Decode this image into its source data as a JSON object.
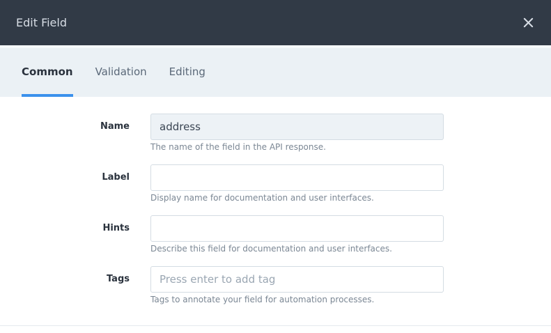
{
  "header": {
    "title": "Edit Field",
    "close_icon": "close-icon"
  },
  "tabs": [
    {
      "label": "Common",
      "active": true
    },
    {
      "label": "Validation",
      "active": false
    },
    {
      "label": "Editing",
      "active": false
    }
  ],
  "fields": {
    "name": {
      "label": "Name",
      "value": "address",
      "hint": "The name of the field in the API response."
    },
    "label": {
      "label": "Label",
      "value": "",
      "hint": "Display name for documentation and user interfaces."
    },
    "hints": {
      "label": "Hints",
      "value": "",
      "hint": "Describe this field for documentation and user interfaces."
    },
    "tags": {
      "label": "Tags",
      "placeholder": "Press enter to add tag",
      "hint": "Tags to annotate your field for automation processes."
    }
  },
  "colors": {
    "header_bg": "#313a46",
    "tab_bar_bg": "#ebf1f5",
    "active_tab_accent": "#3b91ec",
    "readonly_input_bg": "#edf2f6"
  }
}
